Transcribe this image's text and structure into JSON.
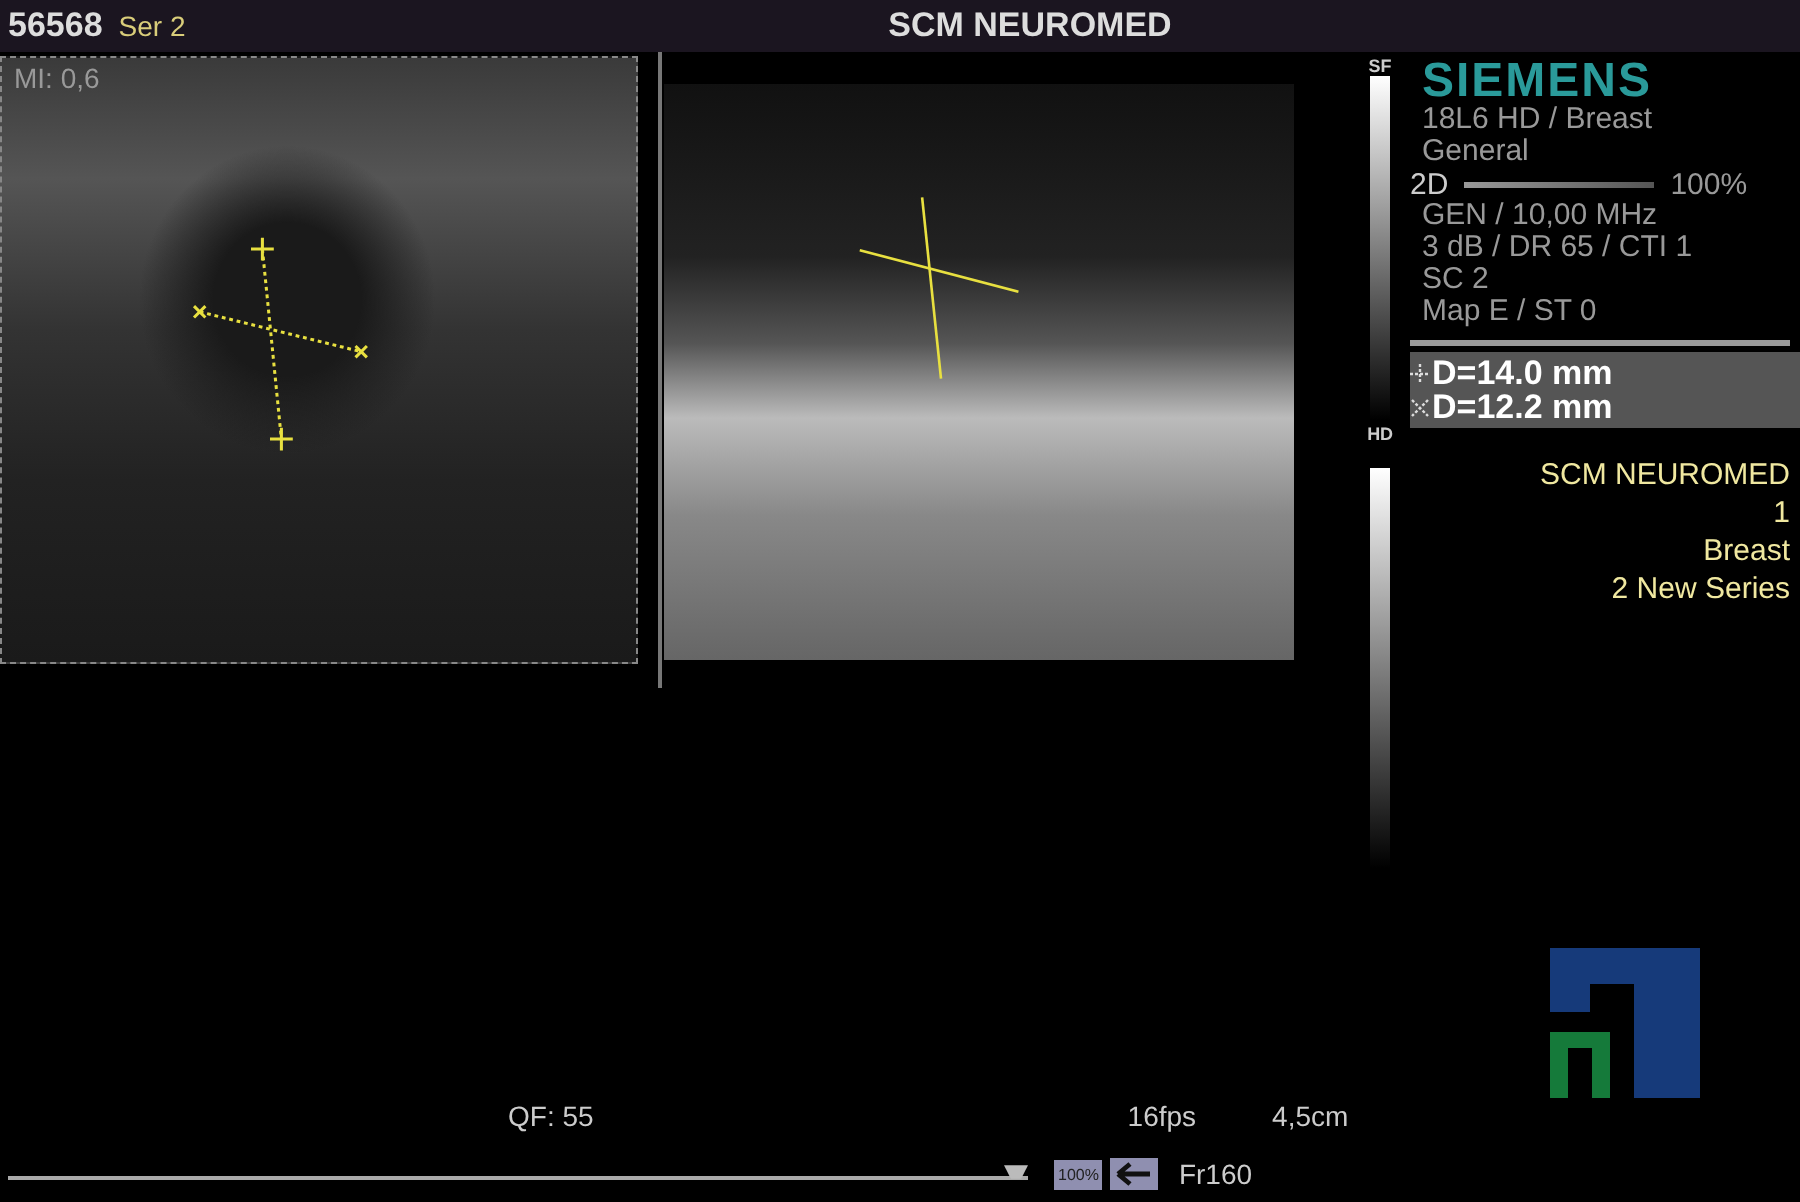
{
  "header": {
    "patient_id": "56568",
    "series": "Ser 2",
    "title": "SCM NEUROMED"
  },
  "left_image": {
    "mi": "MI: 0,6"
  },
  "scale_labels": {
    "top": "SF",
    "bottom": "HD"
  },
  "info_panel": {
    "brand": "SIEMENS",
    "lines": [
      "18L6 HD / Breast",
      "General"
    ],
    "mode": "2D",
    "mode_value": "100%",
    "params": [
      "GEN / 10,00 MHz",
      "3 dB / DR 65 / CTI 1",
      "SC 2",
      "Map E / ST 0"
    ]
  },
  "overlay": [
    "SCM NEUROMED",
    "1",
    "Breast",
    "2 New Series"
  ],
  "measurements": [
    {
      "kind": "plus",
      "text": "D=14.0 mm"
    },
    {
      "kind": "cross",
      "text": "D=12.2 mm"
    }
  ],
  "cine_slider": {
    "level": 1
  },
  "footer": {
    "qf": "QF: 55",
    "fps": "16fps",
    "depth": "4,5cm",
    "zoom": "100%",
    "frame": "Fr160"
  }
}
